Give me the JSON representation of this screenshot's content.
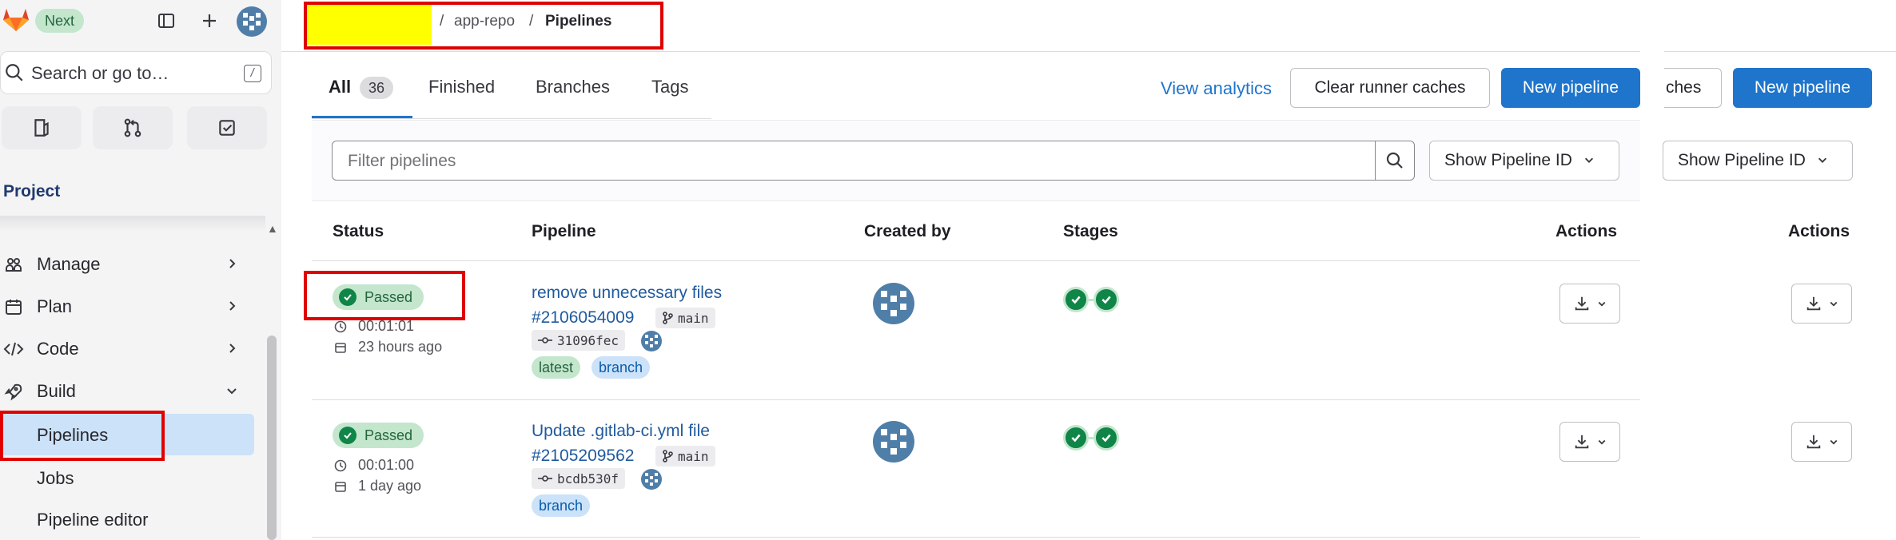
{
  "sidebar": {
    "badge": "Next",
    "search_placeholder": "Search or go to…",
    "search_shortcut": "/",
    "section_title": "Project",
    "nav": [
      {
        "label": "Manage"
      },
      {
        "label": "Plan"
      },
      {
        "label": "Code"
      },
      {
        "label": "Build"
      }
    ],
    "build_items": [
      {
        "label": "Pipelines"
      },
      {
        "label": "Jobs"
      },
      {
        "label": "Pipeline editor"
      }
    ]
  },
  "breadcrumb": {
    "sep1": "/",
    "repo": "app-repo",
    "sep2": "/",
    "current": "Pipelines"
  },
  "tabs": [
    {
      "label": "All",
      "count": "36"
    },
    {
      "label": "Finished"
    },
    {
      "label": "Branches"
    },
    {
      "label": "Tags"
    }
  ],
  "actions": {
    "view_analytics": "View analytics",
    "clear_caches": "Clear runner caches",
    "new_pipeline": "New pipeline",
    "clear_caches_clipped": "ches",
    "new_pipeline_dup": "New pipeline"
  },
  "filter": {
    "placeholder": "Filter pipelines",
    "dropdown": "Show Pipeline ID",
    "dropdown_dup": "Show Pipeline ID"
  },
  "table": {
    "headers": {
      "status": "Status",
      "pipeline": "Pipeline",
      "created_by": "Created by",
      "stages": "Stages",
      "actions": "Actions",
      "actions_dup": "Actions"
    },
    "rows": [
      {
        "status": "Passed",
        "duration": "00:01:01",
        "finished": "23 hours ago",
        "title": "remove unnecessary files",
        "id": "#2106054009",
        "ref": "main",
        "commit": "31096fec",
        "badges": [
          "latest",
          "branch"
        ]
      },
      {
        "status": "Passed",
        "duration": "00:01:00",
        "finished": "1 day ago",
        "title": "Update .gitlab-ci.yml file",
        "id": "#2105209562",
        "ref": "main",
        "commit": "bcdb530f",
        "badges": [
          "branch"
        ]
      }
    ]
  },
  "colors": {
    "primary": "#1f75cb",
    "success": "#108548",
    "success_bg": "#c3e6cd",
    "highlight_box": "#e00000",
    "redaction": "#ffff00"
  }
}
